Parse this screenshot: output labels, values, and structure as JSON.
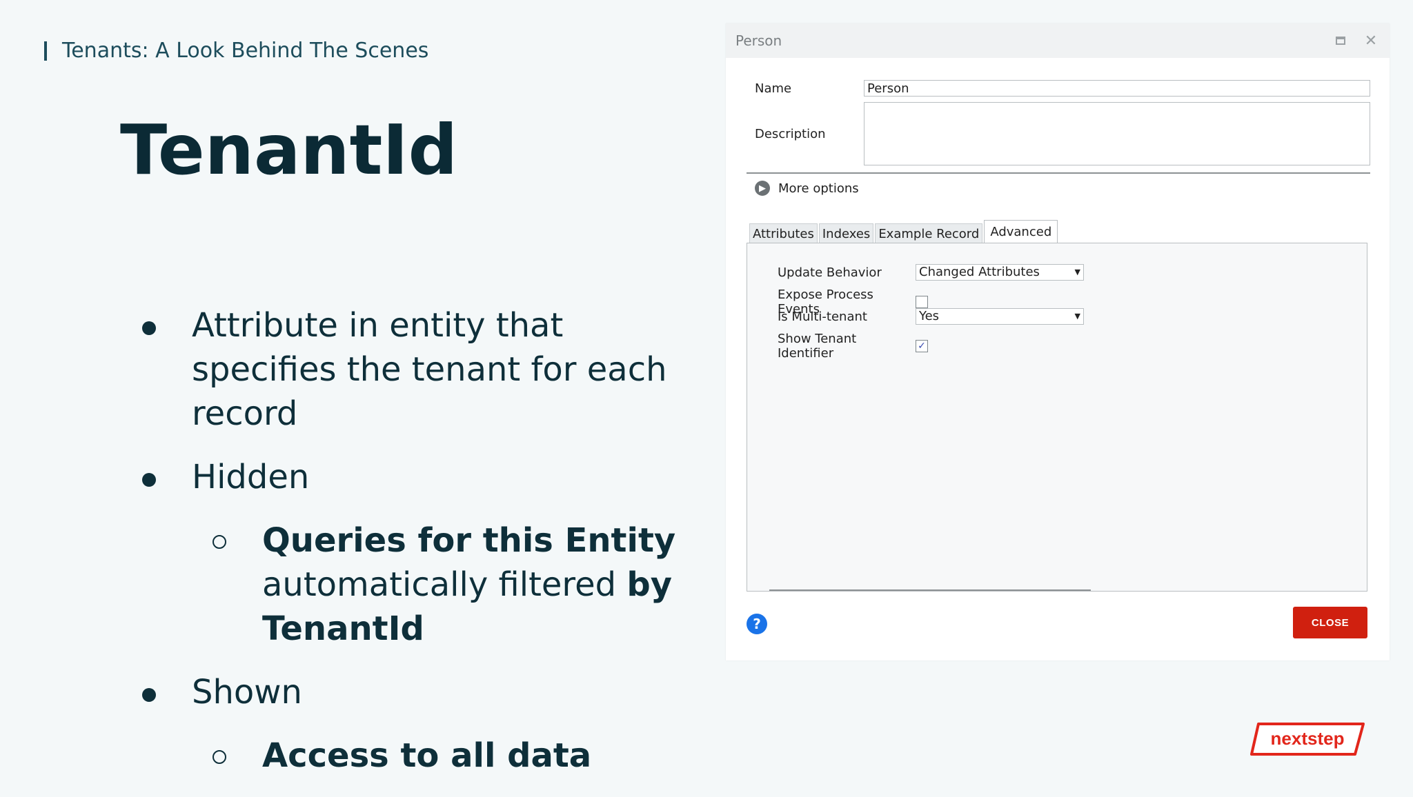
{
  "slide": {
    "kicker": "Tenants: A Look Behind The Scenes",
    "title": "TenantId",
    "bullets": {
      "b1": "Attribute in entity that specifies the tenant for each record",
      "b2": "Hidden",
      "b2_sub_bold": "Queries for this Entity",
      "b2_sub_normal": " automatically filtered ",
      "b2_sub_bold2": "by TenantId",
      "b3": "Shown",
      "b3_sub_bold": "Access to all data"
    }
  },
  "dialog": {
    "title": "Person",
    "name_label": "Name",
    "name_value": "Person",
    "description_label": "Description",
    "more_options": "More options",
    "tabs": [
      "Attributes",
      "Indexes",
      "Example Record",
      "Advanced"
    ],
    "active_tab": "Advanced",
    "update_behavior_label": "Update Behavior",
    "update_behavior_value": "Changed Attributes",
    "expose_events_label": "Expose Process Events",
    "expose_events_checked": false,
    "multi_tenant_label": "Is Multi-tenant",
    "multi_tenant_value": "Yes",
    "show_tenant_label": "Show Tenant Identifier",
    "show_tenant_checked": true,
    "help_symbol": "?",
    "close_label": "CLOSE"
  },
  "logo": {
    "text": "nextstep",
    "color": "#e2261b"
  },
  "icons": {
    "maximize": "maximize-icon",
    "close": "close-x-icon",
    "more_options": "chevron-right-circle-icon",
    "help": "help-icon"
  }
}
